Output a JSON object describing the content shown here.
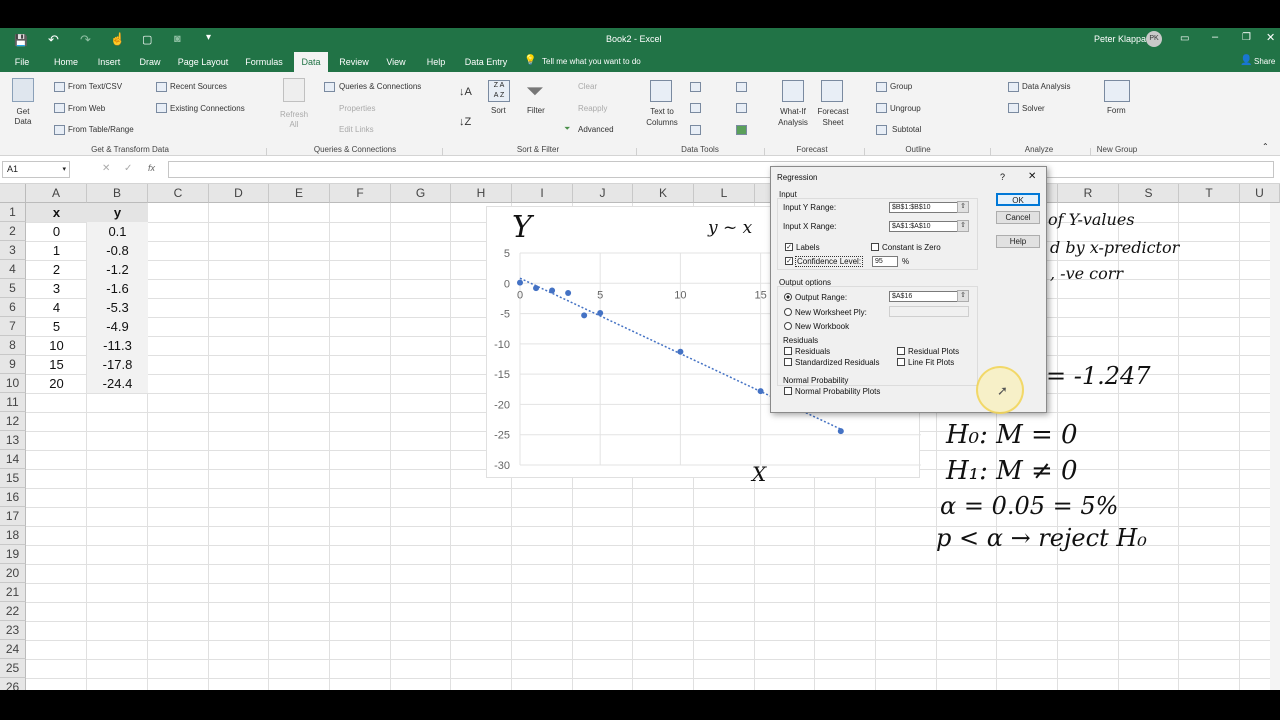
{
  "titlebar": {
    "doc_title": "Book2 - Excel",
    "user": "Peter Klappa",
    "user_initials": "PK"
  },
  "tabs": [
    "File",
    "Home",
    "Insert",
    "Draw",
    "Page Layout",
    "Formulas",
    "Data",
    "Review",
    "View",
    "Help",
    "Data Entry"
  ],
  "tell_me": "Tell me what you want to do",
  "share": "Share",
  "ribbon": {
    "get_data": "Get Data",
    "from_text": "From Text/CSV",
    "from_web": "From Web",
    "from_table": "From Table/Range",
    "recent_sources": "Recent Sources",
    "existing_connections": "Existing Connections",
    "group_get_transform": "Get & Transform Data",
    "refresh_all": "Refresh All",
    "queries_connections": "Queries & Connections",
    "properties": "Properties",
    "edit_links": "Edit Links",
    "group_queries": "Queries & Connections",
    "sort": "Sort",
    "filter": "Filter",
    "clear": "Clear",
    "reapply": "Reapply",
    "advanced": "Advanced",
    "group_sort_filter": "Sort & Filter",
    "text_to_columns": "Text to Columns",
    "group_data_tools": "Data Tools",
    "what_if": "What-If Analysis",
    "forecast_sheet": "Forecast Sheet",
    "group_forecast": "Forecast",
    "group": "Group",
    "ungroup": "Ungroup",
    "subtotal": "Subtotal",
    "group_outline": "Outline",
    "data_analysis": "Data Analysis",
    "solver": "Solver",
    "group_analyze": "Analyze",
    "form": "Form",
    "group_new": "New Group"
  },
  "formula_bar": {
    "name_box": "A1",
    "fx": "fx"
  },
  "columns": [
    "A",
    "B",
    "C",
    "D",
    "E",
    "F",
    "G",
    "H",
    "I",
    "J",
    "K",
    "L",
    "M",
    "N",
    "O",
    "P",
    "Q",
    "R",
    "S",
    "T",
    "U"
  ],
  "rows": [
    "1",
    "2",
    "3",
    "4",
    "5",
    "6",
    "7",
    "8",
    "9",
    "10",
    "11",
    "12",
    "13",
    "14",
    "15",
    "16",
    "17",
    "18",
    "19",
    "20",
    "21",
    "22",
    "23",
    "24",
    "25",
    "26"
  ],
  "table": {
    "headers": [
      "x",
      "y"
    ],
    "rows": [
      [
        "0",
        "0.1"
      ],
      [
        "1",
        "-0.8"
      ],
      [
        "2",
        "-1.2"
      ],
      [
        "3",
        "-1.6"
      ],
      [
        "4",
        "-5.3"
      ],
      [
        "5",
        "-4.9"
      ],
      [
        "10",
        "-11.3"
      ],
      [
        "15",
        "-17.8"
      ],
      [
        "20",
        "-24.4"
      ]
    ]
  },
  "chart_data": {
    "type": "scatter",
    "title": "",
    "x": [
      0,
      1,
      2,
      3,
      4,
      5,
      10,
      15,
      20
    ],
    "y": [
      0.1,
      -0.8,
      -1.2,
      -1.6,
      -5.3,
      -4.9,
      -11.3,
      -17.8,
      -24.4
    ],
    "trendline": "linear",
    "xlim": [
      0,
      25
    ],
    "ylim": [
      -30,
      5
    ],
    "x_ticks": [
      "0",
      "5",
      "10",
      "15"
    ],
    "y_ticks": [
      "5",
      "0",
      "-5",
      "-10",
      "-15",
      "-20",
      "-25",
      "-30"
    ],
    "grid": true,
    "colors": {
      "points": "#4472c4"
    }
  },
  "dialog": {
    "title": "Regression",
    "help_q": "?",
    "close": "✕",
    "input_section": "Input",
    "input_y_label": "Input Y Range:",
    "input_y_value": "$B$1:$B$10",
    "input_x_label": "Input X Range:",
    "input_x_value": "$A$1:$A$10",
    "labels": "Labels",
    "constant_zero": "Constant is Zero",
    "confidence_level": "Confidence Level:",
    "confidence_value": "95",
    "percent": "%",
    "output_section": "Output options",
    "output_range": "Output Range:",
    "output_range_value": "$A$16",
    "new_ply": "New Worksheet Ply:",
    "new_workbook": "New Workbook",
    "residuals_section": "Residuals",
    "residuals": "Residuals",
    "std_residuals": "Standardized Residuals",
    "residual_plots": "Residual Plots",
    "line_fit": "Line Fit Plots",
    "normal_prob_section": "Normal Probability",
    "normal_prob_plots": "Normal Probability Plots",
    "ok": "OK",
    "cancel": "Cancel",
    "help": "Help"
  },
  "annotations": {
    "big_y": "Y",
    "model": "y ~ x",
    "x_label": "X",
    "note1": "of Y-values",
    "note2": "d by x-predictor",
    "note3": ", -ve corr",
    "slope": "= -1.247",
    "h0": "H₀: M = 0",
    "h1": "H₁: M ≠ 0",
    "alpha": "α = 0.05 = 5%",
    "rule": "p < α → reject H₀"
  }
}
